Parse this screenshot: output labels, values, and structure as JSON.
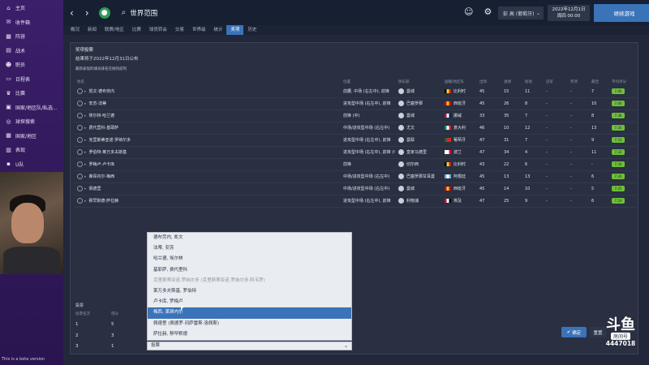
{
  "sidebar": {
    "items": [
      {
        "label": "主页",
        "icon": "home-icon",
        "glyph": "⌂"
      },
      {
        "label": "收件箱",
        "icon": "inbox-icon",
        "glyph": "✉"
      },
      {
        "label": "阵容",
        "icon": "squad-icon",
        "glyph": "▦"
      },
      {
        "label": "战术",
        "icon": "tactics-icon",
        "glyph": "▤"
      },
      {
        "label": "职员",
        "icon": "staff-icon",
        "glyph": "☻"
      },
      {
        "label": "日程表",
        "icon": "calendar-icon",
        "glyph": "▭"
      },
      {
        "label": "比赛",
        "icon": "trophy-icon",
        "glyph": "♛"
      },
      {
        "label": "国家/地区队/私选...",
        "icon": "national-team-icon",
        "glyph": "▣"
      },
      {
        "label": "球探搜索",
        "icon": "scouting-icon",
        "glyph": "◎"
      },
      {
        "label": "国家/地区",
        "icon": "nation-icon",
        "glyph": "▦"
      },
      {
        "label": "表现",
        "icon": "stats-icon",
        "glyph": "▥"
      },
      {
        "label": "U队",
        "icon": "youth-icon",
        "glyph": "▪"
      }
    ],
    "beta_text": "This is a beta version"
  },
  "topbar": {
    "back": "‹",
    "forward": "›",
    "title": "世界范围",
    "manager": "彭 高 (葡萄牙)",
    "date_line1": "2022年12月1日",
    "date_line2": "周四 00:00",
    "continue_label": "继续游戏"
  },
  "tabs": [
    "概况",
    "新闻",
    "联赛/地区",
    "比赛",
    "球员转会",
    "交易",
    "世界级",
    "统计",
    "奖项",
    "历史"
  ],
  "active_tab_index": 8,
  "panel": {
    "title": "奖项投票",
    "subtitle": "结果将于2022年12月31日公布",
    "note": "最新表现的球员排名在榜的前列"
  },
  "table": {
    "headers": [
      "姓名",
      "位置",
      "俱乐部",
      "国籍/地区队",
      "出场",
      "进球",
      "助攻",
      "冠军",
      "奖项",
      "最佳",
      "平均评分"
    ],
    "rows": [
      {
        "name": "凯文·德布劳内",
        "pos": "前腰, 中场 (右左中), 前锋",
        "club": "曼城",
        "nat": "比利时",
        "apps": "45",
        "gls": "15",
        "ast": "11",
        "c1": "-",
        "c2": "-",
        "c3": "7",
        "rating": "7.46",
        "flag": [
          "#000000",
          "#f2d223",
          "#d12030"
        ]
      },
      {
        "name": "安苏·法蒂",
        "pos": "进攻型中场 (右左中), 前锋",
        "club": "巴塞罗那",
        "nat": "西班牙",
        "apps": "45",
        "gls": "26",
        "ast": "8",
        "c1": "-",
        "c2": "-",
        "c3": "10",
        "rating": "7.40",
        "flag": [
          "#c60b1e",
          "#ffc400",
          "#c60b1e"
        ]
      },
      {
        "name": "埃尔林·哈兰德",
        "pos": "前锋 (中)",
        "club": "曼城",
        "nat": "挪威",
        "apps": "33",
        "gls": "35",
        "ast": "7",
        "c1": "-",
        "c2": "-",
        "c3": "8",
        "rating": "7.38",
        "flag": [
          "#ba0c2f",
          "#ffffff",
          "#00205b"
        ]
      },
      {
        "name": "费代里科·基耶萨",
        "pos": "中场/进攻型中场 (右左中)",
        "club": "尤文",
        "nat": "意大利",
        "apps": "46",
        "gls": "10",
        "ast": "12",
        "c1": "-",
        "c2": "-",
        "c3": "13",
        "rating": "7.35",
        "flag": [
          "#009246",
          "#ffffff",
          "#ce2b37"
        ]
      },
      {
        "name": "克里斯蒂亚诺·罗纳尔多",
        "pos": "进攻型中场 (右左中), 前锋",
        "club": "曼联",
        "nat": "葡萄牙",
        "apps": "47",
        "gls": "31",
        "ast": "7",
        "c1": "-",
        "c2": "-",
        "c3": "9",
        "rating": "7.33",
        "flag": [
          "#046a38",
          "#da291c",
          "#da291c"
        ]
      },
      {
        "name": "罗伯特·莱万多夫斯基",
        "pos": "进攻型中场 (右左中), 前锋 (中)",
        "club": "皇家马德里",
        "nat": "波兰",
        "apps": "47",
        "gls": "34",
        "ast": "4",
        "c1": "-",
        "c2": "-",
        "c3": "11",
        "rating": "7.32",
        "flag": [
          "#ffffff",
          "#ffffff",
          "#dc143c"
        ]
      },
      {
        "name": "罗梅卢·卢卡库",
        "pos": "前锋",
        "club": "切尔西",
        "nat": "比利时",
        "apps": "43",
        "gls": "22",
        "ast": "6",
        "c1": "-",
        "c2": "-",
        "c3": "-",
        "rating": "7.30",
        "flag": [
          "#000000",
          "#f2d223",
          "#d12030"
        ]
      },
      {
        "name": "莱昂内尔·梅西",
        "pos": "中场/进攻型中场 (右左中)",
        "club": "巴塞罗那甘耳曼",
        "nat": "阿根廷",
        "apps": "45",
        "gls": "13",
        "ast": "13",
        "c1": "-",
        "c2": "-",
        "c3": "6",
        "rating": "7.26",
        "flag": [
          "#74acdf",
          "#ffffff",
          "#74acdf"
        ]
      },
      {
        "name": "佩德里",
        "pos": "中场/进攻型中场 (右左中)",
        "club": "曼城",
        "nat": "西班牙",
        "apps": "45",
        "gls": "14",
        "ast": "10",
        "c1": "-",
        "c2": "-",
        "c3": "5",
        "rating": "7.25",
        "flag": [
          "#c60b1e",
          "#ffc400",
          "#c60b1e"
        ]
      },
      {
        "name": "穆罕默德·萨拉赫",
        "pos": "进攻型中场 (右左中), 前锋",
        "club": "利物浦",
        "nat": "埃及",
        "apps": "47",
        "gls": "25",
        "ast": "9",
        "c1": "-",
        "c2": "-",
        "c3": "6",
        "rating": "7.24",
        "flag": [
          "#ce1126",
          "#ffffff",
          "#000000"
        ]
      }
    ]
  },
  "votes": {
    "title": "投票",
    "headers": [
      "投票名次",
      "得分"
    ],
    "rows": [
      {
        "rank": "1",
        "points": "5"
      },
      {
        "rank": "2",
        "points": "3"
      },
      {
        "rank": "3",
        "points": "1"
      }
    ],
    "select3_value": "投票"
  },
  "dropdown": {
    "options": [
      {
        "label": "德布劳内, 凯文",
        "state": "normal"
      },
      {
        "label": "法蒂, 安苏",
        "state": "normal"
      },
      {
        "label": "哈兰德, 埃尔林",
        "state": "normal"
      },
      {
        "label": "基耶萨, 费代里科",
        "state": "normal"
      },
      {
        "label": "克里斯蒂亚诺·罗纳尔多 (克里斯蒂亚诺·罗纳尔多·阿韦罗)",
        "state": "disabled"
      },
      {
        "label": "莱万多夫斯基, 罗伯特",
        "state": "normal"
      },
      {
        "label": "卢卡库, 罗梅卢",
        "state": "normal"
      },
      {
        "label": "梅西, 莱昂内尔",
        "state": "highlighted"
      },
      {
        "label": "佩德里 (佩德罗·冈萨雷斯·洛佩斯)",
        "state": "normal"
      },
      {
        "label": "萨拉赫, 穆罕默德",
        "state": "normal"
      }
    ]
  },
  "buttons": {
    "confirm": "确定",
    "reset": "重置"
  },
  "watermark": {
    "logo": "斗鱼",
    "tag": "房间号",
    "room": "4447018"
  }
}
